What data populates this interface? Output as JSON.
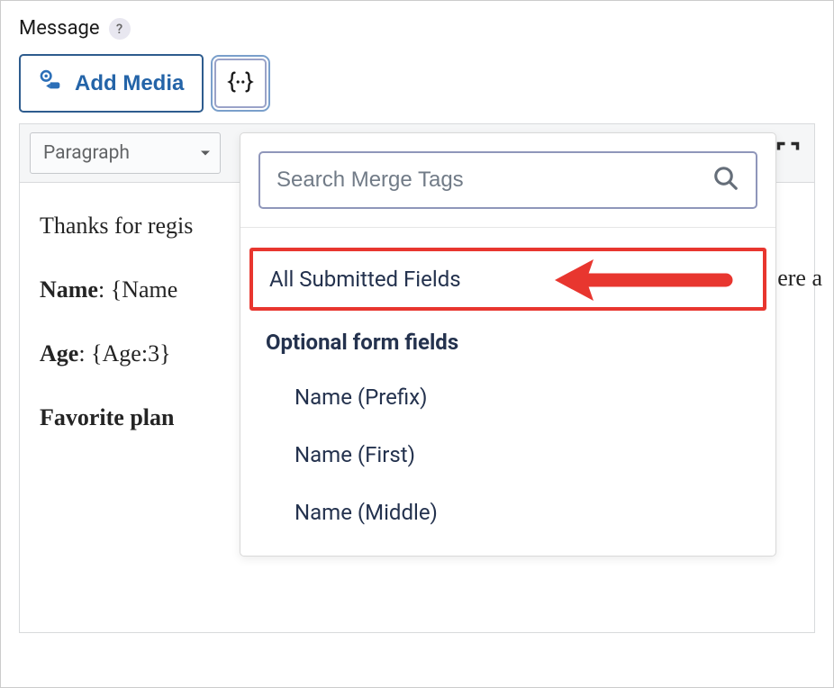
{
  "field": {
    "label": "Message",
    "help": "?"
  },
  "buttons": {
    "add_media": "Add Media"
  },
  "toolbar": {
    "paragraph_label": "Paragraph"
  },
  "content": {
    "line1": "Thanks for regis",
    "text_behind": "ere a",
    "name_label": "Name",
    "name_value": ": {Name",
    "age_label": "Age",
    "age_value": ": {Age:3}",
    "favorite_label": "Favorite plan"
  },
  "dropdown": {
    "search_placeholder": "Search Merge Tags",
    "all_fields": "All Submitted Fields",
    "optional_header": "Optional form fields",
    "subitems": {
      "prefix": "Name (Prefix)",
      "first": "Name (First)",
      "middle": "Name (Middle)"
    }
  }
}
